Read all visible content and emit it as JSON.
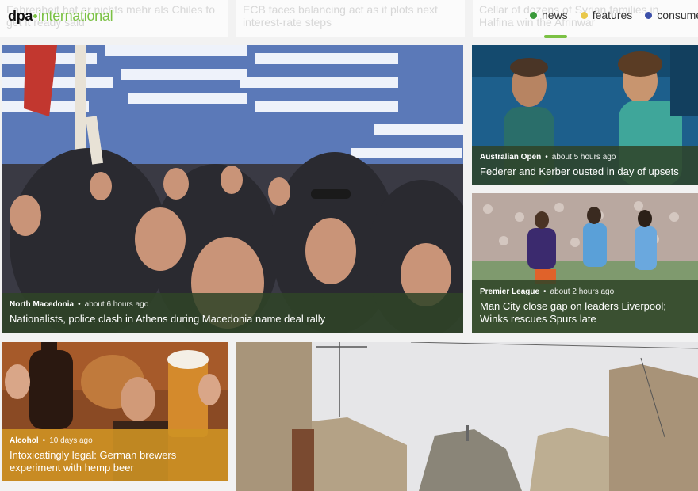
{
  "header": {
    "logo": {
      "brand": "dpa",
      "suffix": "international"
    },
    "ticker": [
      "Fahrenheit hat er nichts mehr als Chiles to get it ready said",
      "ECB faces balancing act as it plots next interest-rate steps",
      "Cellar of dozens of Syrian families in Halfina win the Afrinwar"
    ],
    "categories": [
      {
        "label": "news",
        "color": "#3a9a3a"
      },
      {
        "label": "features",
        "color": "#e9c84a"
      },
      {
        "label": "consumer",
        "color": "#3b4fa8"
      }
    ]
  },
  "articles": {
    "main": {
      "category": "North Macedonia",
      "time": "about 6 hours ago",
      "headline": "Nationalists, police clash in Athens during Macedonia name deal rally"
    },
    "tennis": {
      "category": "Australian Open",
      "time": "about 5 hours ago",
      "headline": "Federer and Kerber ousted in day of upsets"
    },
    "football": {
      "category": "Premier League",
      "time": "about 2 hours ago",
      "headline": "Man City close gap on leaders Liverpool; Winks rescues Spurs late"
    },
    "beer": {
      "category": "Alcohol",
      "time": "10 days ago",
      "headline": "Intoxicatingly legal: German brewers experiment with hemp beer"
    }
  }
}
